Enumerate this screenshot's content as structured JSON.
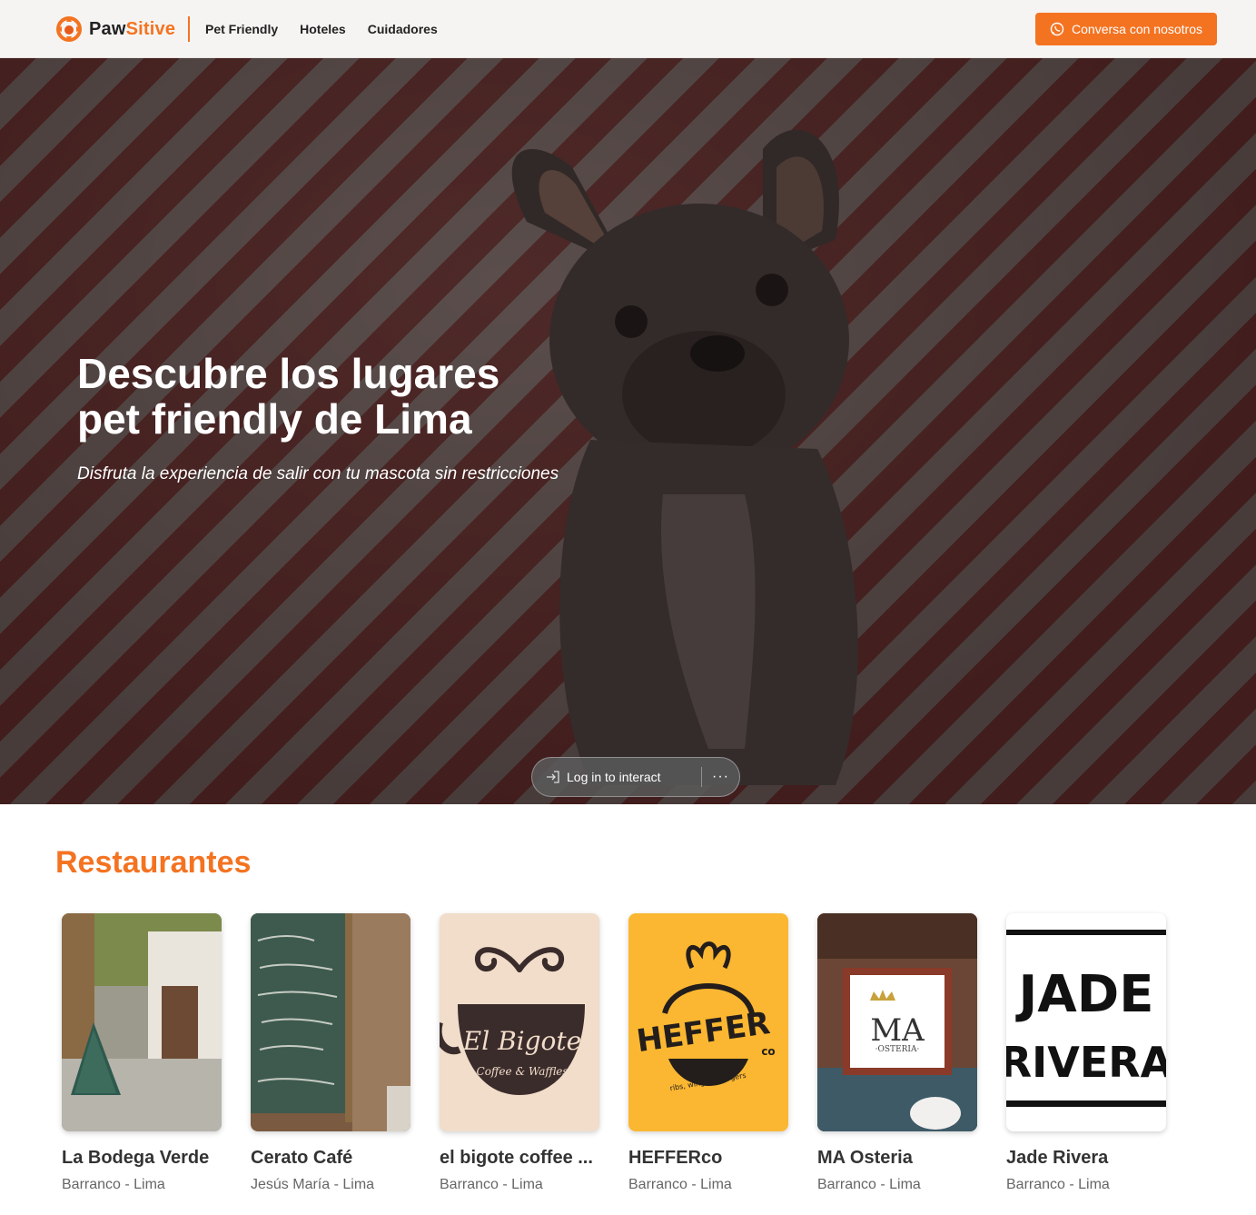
{
  "header": {
    "brand_prefix": "Paw",
    "brand_suffix": "Sitive",
    "nav": [
      "Pet Friendly",
      "Hoteles",
      "Cuidadores"
    ],
    "cta_label": "Conversa con nosotros",
    "cta_icon": "whatsapp-icon",
    "accent_color": "#f47321"
  },
  "hero": {
    "title_line1": "Descubre los lugares",
    "title_line2": "pet friendly de Lima",
    "subtitle": "Disfruta la experiencia de salir con tu mascota sin restricciones",
    "login_label": "Log in to interact",
    "more_label": "···"
  },
  "restaurants": {
    "title": "Restaurantes",
    "items": [
      {
        "name": "La Bodega Verde",
        "location": "Barranco - Lima"
      },
      {
        "name": "Cerato Café",
        "location": "Jesús María - Lima"
      },
      {
        "name": "el bigote coffee ...",
        "location": "Barranco - Lima",
        "logo_text": "El Bigote",
        "logo_sub": "Coffee & Waffles"
      },
      {
        "name": "HEFFERco",
        "location": "Barranco - Lima",
        "logo_text": "HEFFER",
        "logo_co": "co",
        "logo_sub": "ribs, wings & burgers"
      },
      {
        "name": "MA Osteria",
        "location": "Barranco - Lima",
        "logo_text": "MA",
        "logo_sub": "·OSTERIA·"
      },
      {
        "name": "Jade Rivera",
        "location": "Barranco - Lima",
        "logo_line1": "JADE",
        "logo_line2": "RIVERA"
      }
    ]
  }
}
